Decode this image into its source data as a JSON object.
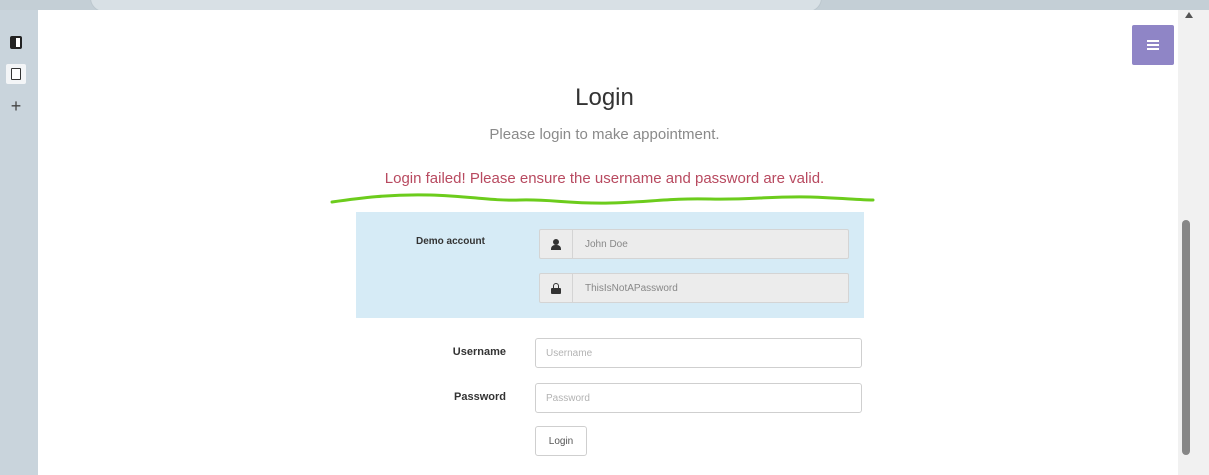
{
  "header": {
    "title": "Login",
    "subtitle": "Please login to make appointment."
  },
  "error": {
    "message": "Login failed! Please ensure the username and password are valid.",
    "underline_color": "#6ccc1c"
  },
  "demo_account": {
    "label": "Demo account",
    "username": "John Doe",
    "password": "ThisIsNotAPassword"
  },
  "form": {
    "username_label": "Username",
    "username_placeholder": "Username",
    "password_label": "Password",
    "password_placeholder": "Password",
    "login_button": "Login"
  },
  "icons": {
    "menu": "hamburger-menu-icon",
    "user": "user-icon",
    "lock": "lock-icon"
  },
  "colors": {
    "menu_button": "#8f85c6",
    "demo_box": "#d6ebf6",
    "error_text": "#b84a60"
  }
}
